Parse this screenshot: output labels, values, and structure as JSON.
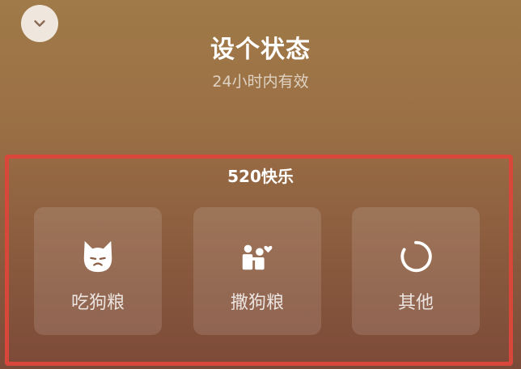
{
  "header": {
    "title": "设个状态",
    "subtitle": "24小时内有效",
    "collapse_icon": "chevron-down-icon"
  },
  "section": {
    "title": "520快乐",
    "highlight_color": "#d9473a",
    "options": [
      {
        "label": "吃狗粮",
        "icon": "cat-face-icon"
      },
      {
        "label": "撒狗粮",
        "icon": "couple-heart-icon"
      },
      {
        "label": "其他",
        "icon": "loading-circle-icon"
      }
    ]
  }
}
